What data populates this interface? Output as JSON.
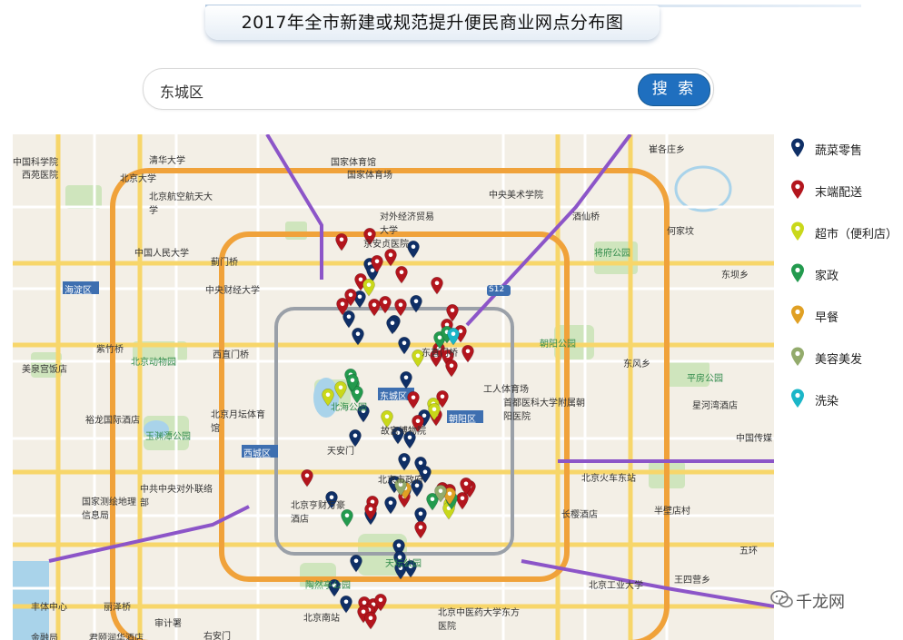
{
  "title": "2017年全市新建或规范提升便民商业网点分布图",
  "search": {
    "value": "东城区",
    "button_label": "搜 索"
  },
  "legend": [
    {
      "label": "蔬菜零售",
      "color": "#0f2f66",
      "icon": "map-pin-icon"
    },
    {
      "label": "末端配送",
      "color": "#b3151d",
      "icon": "map-pin-icon"
    },
    {
      "label": "超市（便利店）",
      "color": "#c9d81a",
      "icon": "map-pin-icon"
    },
    {
      "label": "家政",
      "color": "#239a4e",
      "icon": "map-pin-icon"
    },
    {
      "label": "早餐",
      "color": "#e0a024",
      "icon": "map-pin-icon"
    },
    {
      "label": "美容美发",
      "color": "#93ab6c",
      "icon": "map-pin-icon"
    },
    {
      "label": "洗染",
      "color": "#1bb6c8",
      "icon": "map-pin-icon"
    }
  ],
  "map": {
    "district_labels": [
      "海淀区",
      "东城区",
      "朝阳区",
      "西城区"
    ],
    "road_shields": [
      "S12"
    ],
    "place_labels": [
      "中国科学院",
      "西苑医院",
      "清华大学",
      "北京大学",
      "北京航空航天大学",
      "国家体育馆",
      "国家体育场",
      "对外经济贸易大学",
      "京安贞医院",
      "中国人民大学",
      "蓟门桥",
      "中央财经大学",
      "中央美术学院",
      "酒仙桥",
      "崔各庄乡",
      "何家坟",
      "将府公园",
      "东坝乡",
      "紫竹桥",
      "西直门桥",
      "东直门桥",
      "北京动物园",
      "美泉宫饭店",
      "工人体育场",
      "首都医科大学附属朝阳医院",
      "朝阳公园",
      "东风乡",
      "平房公园",
      "星河湾酒店",
      "裕龙国际酒店",
      "北京月坛体育馆",
      "北海公园",
      "故宫博物院",
      "玉渊潭公园",
      "天安门",
      "北京市政府",
      "北京火车东站",
      "中共中央对外联络部",
      "国家测绘地理信息局",
      "北京亨财万豪酒店",
      "长樱酒店",
      "半壁店村",
      "中国传媒",
      "天坛公园",
      "陶然亭公园",
      "北京工业大学",
      "王四营乡",
      "丰体中心",
      "丽泽桥",
      "审计署",
      "北京南站",
      "右安门",
      "北京中医药大学东方医院",
      "君颐润华酒店",
      "金融局",
      "五环"
    ]
  },
  "pin_groups": {
    "vegetable": [
      [
        441,
        136
      ],
      [
        393,
        155
      ],
      [
        396,
        162
      ],
      [
        382,
        191
      ],
      [
        370,
        213
      ],
      [
        444,
        196
      ],
      [
        420,
        218
      ],
      [
        380,
        232
      ],
      [
        431,
        242
      ],
      [
        418,
        220
      ],
      [
        433,
        280
      ],
      [
        386,
        317
      ],
      [
        377,
        344
      ],
      [
        424,
        341
      ],
      [
        437,
        346
      ],
      [
        431,
        370
      ],
      [
        453,
        322
      ],
      [
        420,
        395
      ],
      [
        378,
        482
      ],
      [
        432,
        404
      ],
      [
        416,
        418
      ],
      [
        425,
        465
      ],
      [
        449,
        430
      ],
      [
        351,
        412
      ],
      [
        394,
        430
      ],
      [
        354,
        509
      ],
      [
        367,
        527
      ],
      [
        427,
        490
      ],
      [
        438,
        488
      ],
      [
        426,
        478
      ],
      [
        445,
        399
      ],
      [
        449,
        374
      ],
      [
        454,
        384
      ]
    ],
    "delivery": [
      [
        362,
        128
      ],
      [
        393,
        122
      ],
      [
        416,
        145
      ],
      [
        401,
        152
      ],
      [
        383,
        172
      ],
      [
        428,
        164
      ],
      [
        467,
        176
      ],
      [
        372,
        189
      ],
      [
        363,
        199
      ],
      [
        398,
        200
      ],
      [
        410,
        197
      ],
      [
        427,
        200
      ],
      [
        484,
        206
      ],
      [
        478,
        222
      ],
      [
        493,
        229
      ],
      [
        469,
        248
      ],
      [
        466,
        256
      ],
      [
        479,
        256
      ],
      [
        501,
        251
      ],
      [
        483,
        267
      ],
      [
        441,
        302
      ],
      [
        473,
        301
      ],
      [
        466,
        321
      ],
      [
        446,
        328
      ],
      [
        324,
        388
      ],
      [
        396,
        417
      ],
      [
        431,
        411
      ],
      [
        473,
        402
      ],
      [
        481,
        404
      ],
      [
        495,
        413
      ],
      [
        503,
        400
      ],
      [
        387,
        528
      ],
      [
        397,
        530
      ],
      [
        405,
        525
      ],
      [
        392,
        536
      ],
      [
        386,
        538
      ],
      [
        394,
        545
      ],
      [
        449,
        445
      ],
      [
        394,
        425
      ],
      [
        499,
        397
      ]
    ],
    "supermarket": [
      [
        347,
        299
      ],
      [
        361,
        291
      ],
      [
        446,
        256
      ],
      [
        463,
        309
      ],
      [
        464,
        315
      ],
      [
        412,
        323
      ],
      [
        481,
        419
      ],
      [
        480,
        424
      ],
      [
        392,
        178
      ]
    ],
    "housekeeping": [
      [
        372,
        277
      ],
      [
        375,
        287
      ],
      [
        379,
        296
      ],
      [
        374,
        283
      ],
      [
        470,
        236
      ],
      [
        478,
        230
      ],
      [
        462,
        414
      ],
      [
        368,
        432
      ],
      [
        483,
        413
      ]
    ],
    "breakfast": [
      [
        432,
        402
      ],
      [
        481,
        408
      ]
    ],
    "beauty": [
      [
        471,
        405
      ],
      [
        427,
        398
      ]
    ],
    "laundry": [
      [
        485,
        232
      ]
    ]
  }
}
